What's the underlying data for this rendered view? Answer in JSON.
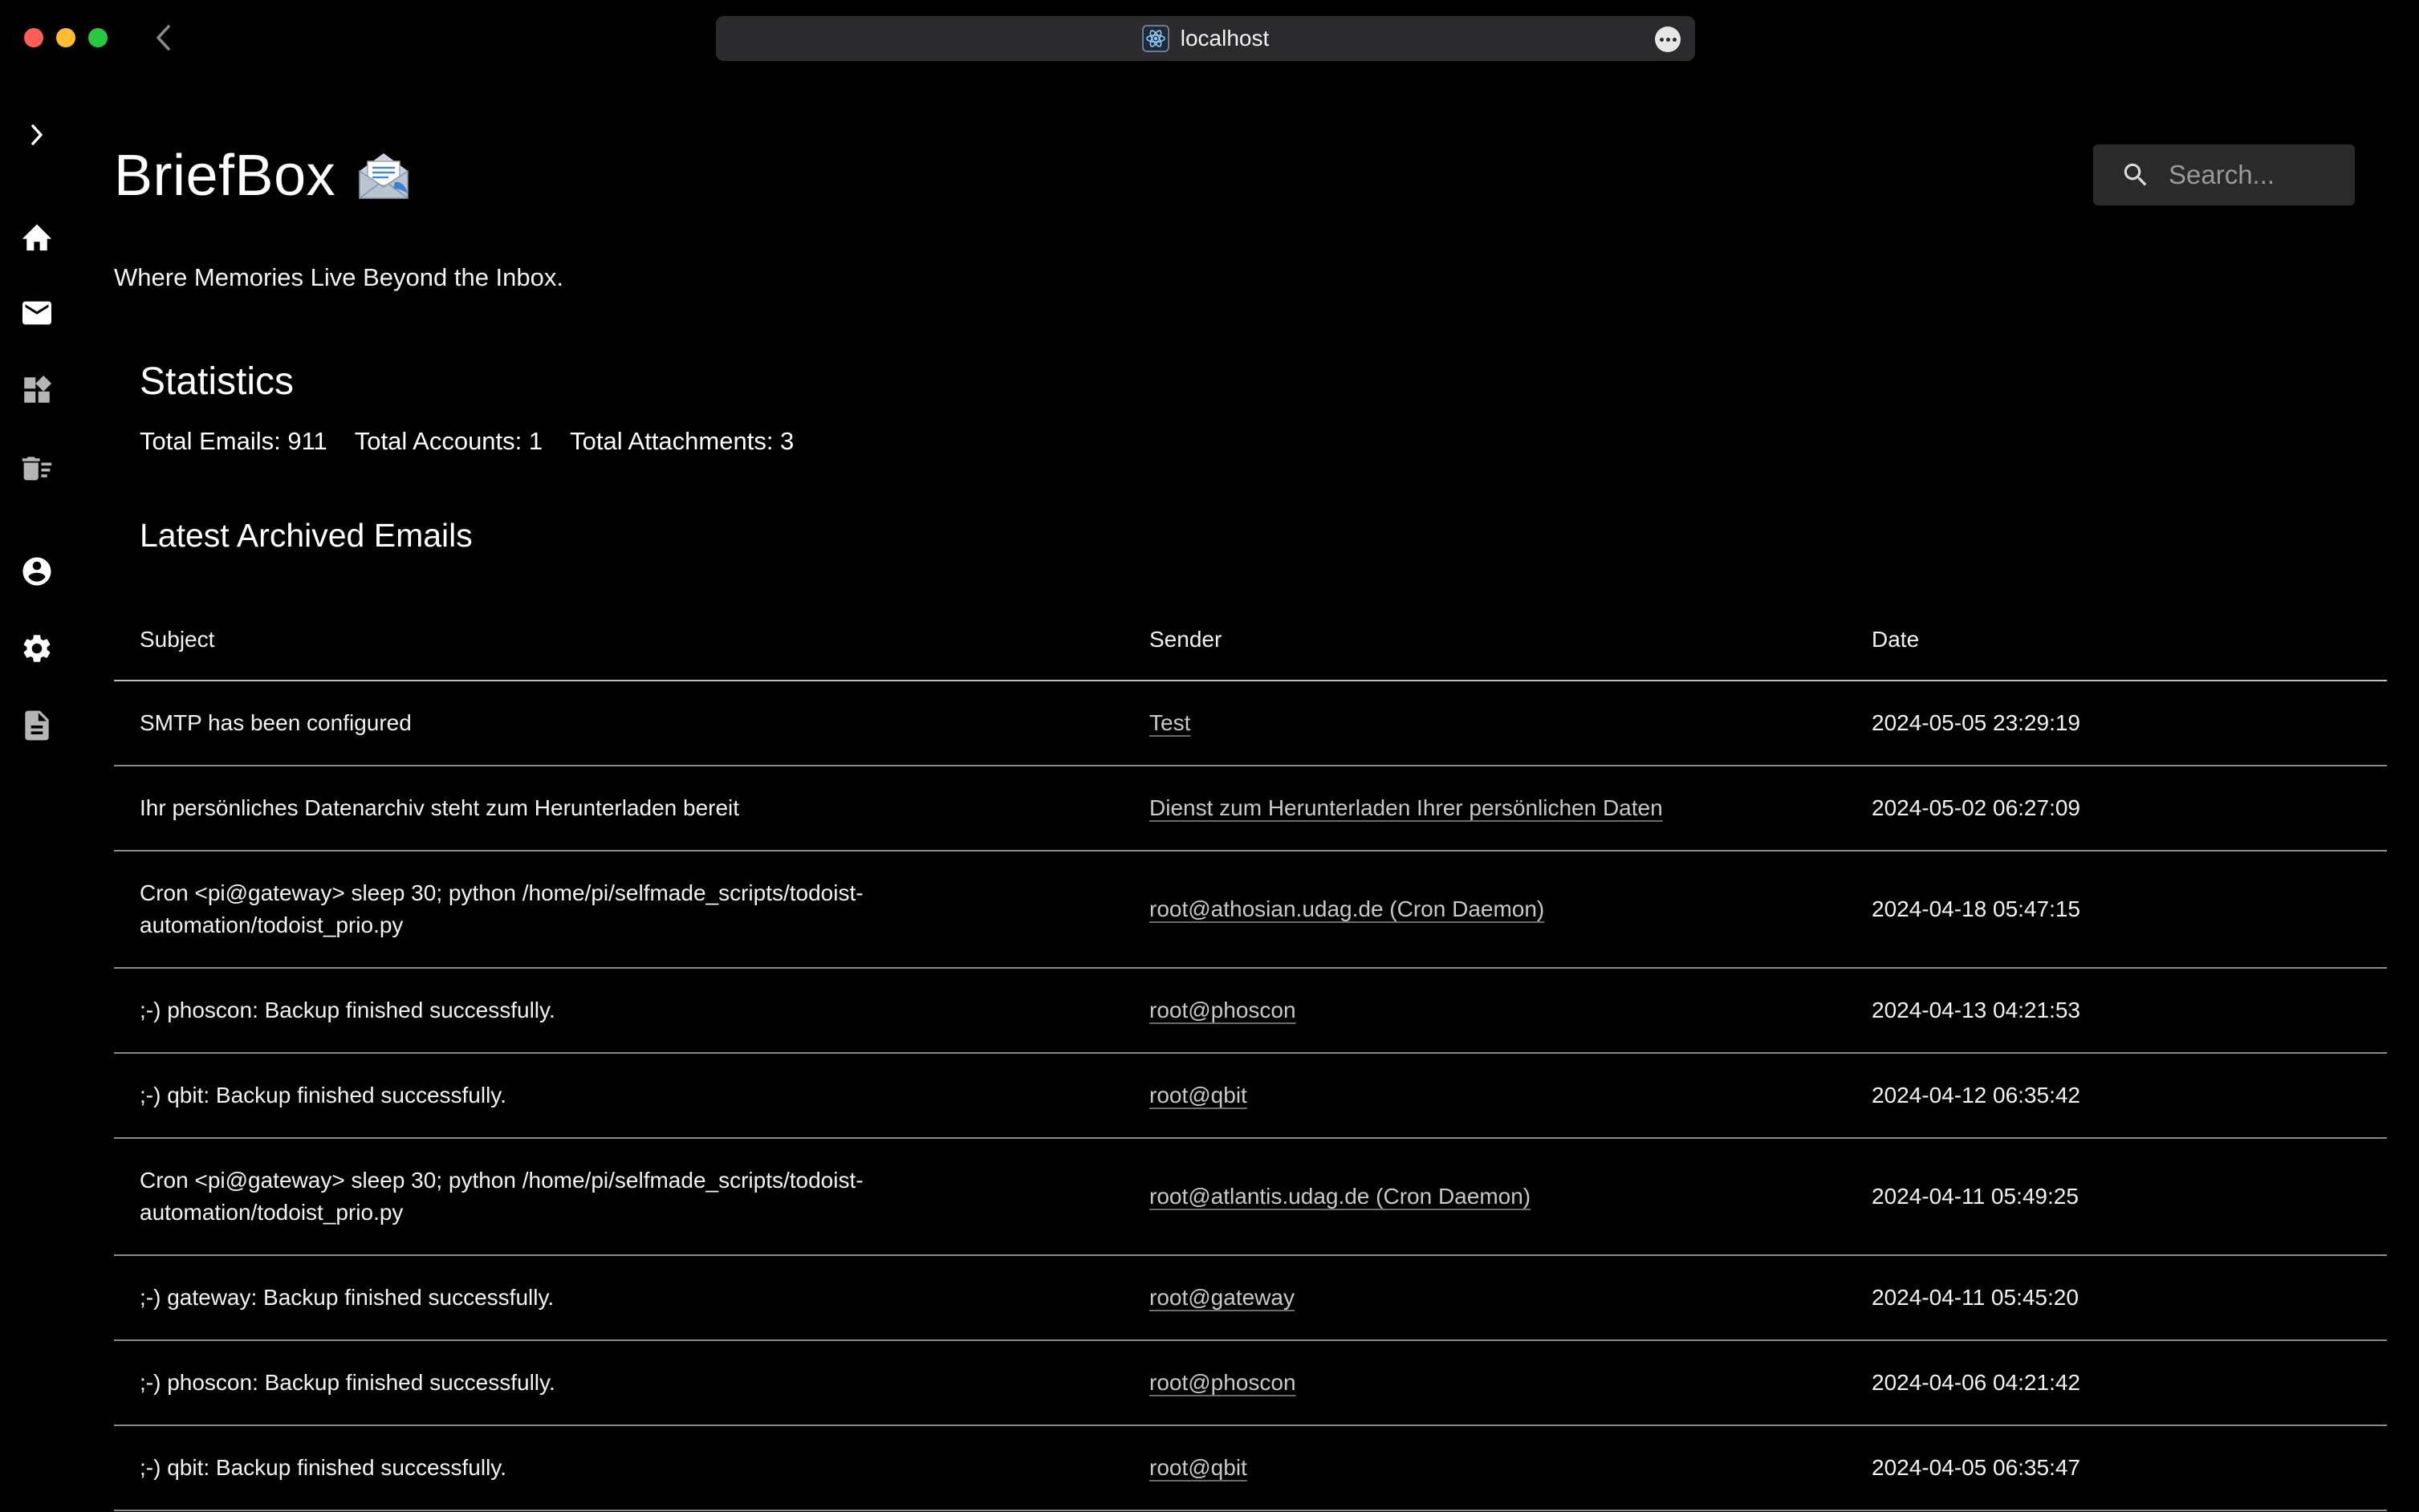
{
  "browser": {
    "url": "localhost"
  },
  "header": {
    "title": "BriefBox",
    "tagline": "Where Memories Live Beyond the Inbox.",
    "search_placeholder": "Search..."
  },
  "statistics": {
    "title": "Statistics",
    "total_emails": "Total Emails: 911",
    "total_accounts": "Total Accounts: 1",
    "total_attachments": "Total Attachments: 3"
  },
  "latest": {
    "title": "Latest Archived Emails",
    "columns": [
      "Subject",
      "Sender",
      "Date"
    ],
    "rows": [
      {
        "subject": "SMTP has been configured",
        "sender": "Test",
        "date": "2024-05-05 23:29:19"
      },
      {
        "subject": "Ihr persönliches Datenarchiv steht zum Herunterladen bereit",
        "sender": "Dienst zum Herunterladen Ihrer persönlichen Daten",
        "date": "2024-05-02 06:27:09"
      },
      {
        "subject": "Cron <pi@gateway> sleep 30; python /home/pi/selfmade_scripts/todoist-automation/todoist_prio.py",
        "sender": "root@athosian.udag.de (Cron Daemon)",
        "date": "2024-04-18 05:47:15"
      },
      {
        "subject": ";-) phoscon: Backup finished successfully.",
        "sender": "root@phoscon",
        "date": "2024-04-13 04:21:53"
      },
      {
        "subject": ";-) qbit: Backup finished successfully.",
        "sender": "root@qbit",
        "date": "2024-04-12 06:35:42"
      },
      {
        "subject": "Cron <pi@gateway> sleep 30; python /home/pi/selfmade_scripts/todoist-automation/todoist_prio.py",
        "sender": "root@atlantis.udag.de (Cron Daemon)",
        "date": "2024-04-11 05:49:25"
      },
      {
        "subject": ";-) gateway: Backup finished successfully.",
        "sender": "root@gateway",
        "date": "2024-04-11 05:45:20"
      },
      {
        "subject": ";-) phoscon: Backup finished successfully.",
        "sender": "root@phoscon",
        "date": "2024-04-06 04:21:42"
      },
      {
        "subject": ";-) qbit: Backup finished successfully.",
        "sender": "root@qbit",
        "date": "2024-04-05 06:35:47"
      }
    ]
  },
  "sidebar": {
    "items": [
      {
        "name": "expand-sidebar-button",
        "icon": "chevron-right-icon"
      },
      {
        "name": "sidebar-item-home",
        "icon": "home-icon"
      },
      {
        "name": "sidebar-item-emails",
        "icon": "mail-icon"
      },
      {
        "name": "sidebar-item-dashboard",
        "icon": "dashboard-icon"
      },
      {
        "name": "sidebar-item-delete-list",
        "icon": "delete-sweep-icon"
      },
      {
        "name": "sidebar-item-account",
        "icon": "account-circle-icon"
      },
      {
        "name": "sidebar-item-settings",
        "icon": "gear-icon"
      },
      {
        "name": "sidebar-item-documents",
        "icon": "document-icon"
      }
    ]
  }
}
